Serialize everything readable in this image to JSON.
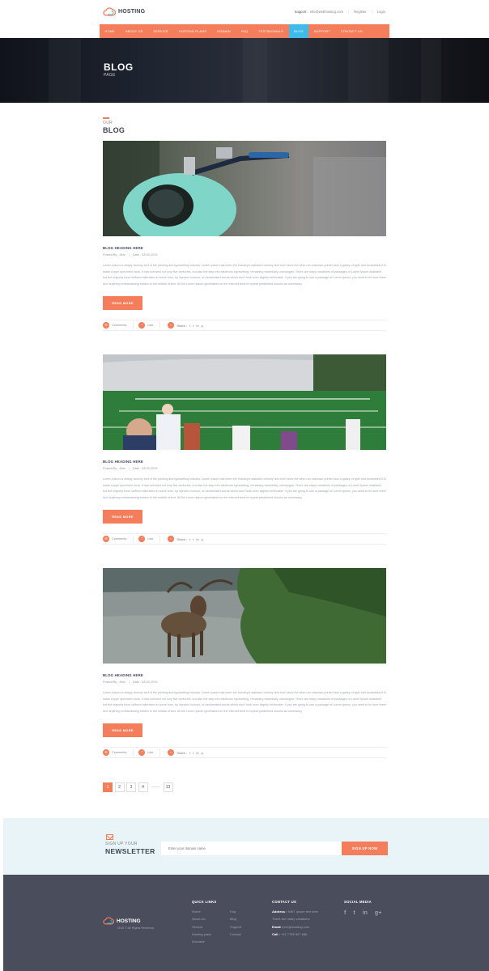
{
  "brand": {
    "name": "HOSTING",
    "accent": "#f47d5b",
    "highlight": "#3dbcea"
  },
  "topbar": {
    "support_label": "Support :",
    "support_email": "info@webhosting.com",
    "register": "Register",
    "login": "Login"
  },
  "nav": {
    "items": [
      "HOME",
      "ABOUT US",
      "SERVICE",
      "HOSTING PLANS",
      "DOMAIN",
      "FAQ",
      "TESTIMONIALS",
      "BLOG",
      "SUPPORT",
      "CONTACT US"
    ],
    "active": "BLOG"
  },
  "hero": {
    "title": "BLOG",
    "subtitle": "PAGE"
  },
  "section": {
    "small": "OUR",
    "big": "BLOG"
  },
  "posts": [
    {
      "image": "scooter-photo",
      "heading": "BLOG HEADING HERE",
      "posted_by": "Posted By : Abhi",
      "date": "Date : 02-02-2015",
      "text": "Lorem Ipsum is simply dummy text of the printing and typesetting industry. Lorem Ipsum has been the industry's standard dummy text ever since the when an unknown printer took a galley of type and scrambled it to make a type specimen book. It has survived not only five centuries, but also the leap into electronic typesetting, remaining essentially unchanged. There are many variations of passages of Lorem Ipsum available, but the majority have suffered alteration in some form, by injected humour, or randomised words which don't look even slightly believable. If you are going to use a passage of Lorem Ipsum, you need to be sure there isn't anything embarrassing hidden in the middle of text. All the Lorem Ipsum generators on the Internet tend to repeat predefined chunks as necessary.",
      "read_more": "READ MORE",
      "comments": "Comments",
      "like": "Like",
      "share": "Share :"
    },
    {
      "image": "stadium-photo",
      "heading": "BLOG HEADING HERE",
      "posted_by": "Posted By : Abhi",
      "date": "Date : 02-02-2015",
      "text": "Lorem Ipsum is simply dummy text of the printing and typesetting industry. Lorem Ipsum has been the industry's standard dummy text ever since the when an unknown printer took a galley of type and scrambled it to make a type specimen book. It has survived not only five centuries, but also the leap into electronic typesetting, remaining essentially unchanged. There are many variations of passages of Lorem Ipsum available, but the majority have suffered alteration in some form, by injected humour, or randomised words which don't look even slightly believable. If you are going to use a passage of Lorem Ipsum, you need to be sure there isn't anything embarrassing hidden in the middle of text. All the Lorem Ipsum generators on the Internet tend to repeat predefined chunks as necessary.",
      "read_more": "READ MORE",
      "comments": "Comments",
      "like": "Like",
      "share": "Share :"
    },
    {
      "image": "moose-photo",
      "heading": "BLOG HEADING HERE",
      "posted_by": "Posted By : Abhi",
      "date": "Date : 02-02-2015",
      "text": "Lorem Ipsum is simply dummy text of the printing and typesetting industry. Lorem Ipsum has been the industry's standard dummy text ever since the when an unknown printer took a galley of type and scrambled it to make a type specimen book. It has survived not only five centuries, but also the leap into electronic typesetting, remaining essentially unchanged. There are many variations of passages of Lorem Ipsum available, but the majority have suffered alteration in some form, by injected humour, or randomised words which don't look even slightly believable. If you are going to use a passage of Lorem Ipsum, you need to be sure there isn't anything embarrassing hidden in the middle of text. All the Lorem Ipsum generators on the Internet tend to repeat predefined chunks as necessary.",
      "read_more": "READ MORE",
      "comments": "Comments",
      "like": "Like",
      "share": "Share :"
    }
  ],
  "share_icons": [
    "f",
    "t",
    "in",
    "p"
  ],
  "pagination": {
    "pages": [
      "1",
      "2",
      "3",
      "4",
      "........",
      "13"
    ],
    "active": "1"
  },
  "newsletter": {
    "small": "SIGN UP YOUR",
    "big": "NEWSLETTER",
    "placeholder": "Enter your domain name",
    "button": "SIGN UP NOW"
  },
  "footer": {
    "brand": "HOSTING",
    "copyright": "2015 © All Rights Reserved",
    "quick_links_title": "QUICK LINKS",
    "quick_links_col1": [
      "Home",
      "About Us",
      "Service",
      "Hosting plans",
      "Domains"
    ],
    "quick_links_col2": [
      "Faq",
      "Blog",
      "Support",
      "Contact"
    ],
    "contact_title": "CONTACT US",
    "address_label": "Address :",
    "address_line1": "9467 Ipsum text here",
    "address_line2": "There are many variations",
    "email_label": "Email :",
    "email": "info@hosting.com",
    "call_label": "Call :",
    "call": "+91 7765 557 886",
    "social_title": "SOCIAL MEDIA",
    "social_icons": [
      "f",
      "t",
      "in",
      "g+"
    ]
  }
}
